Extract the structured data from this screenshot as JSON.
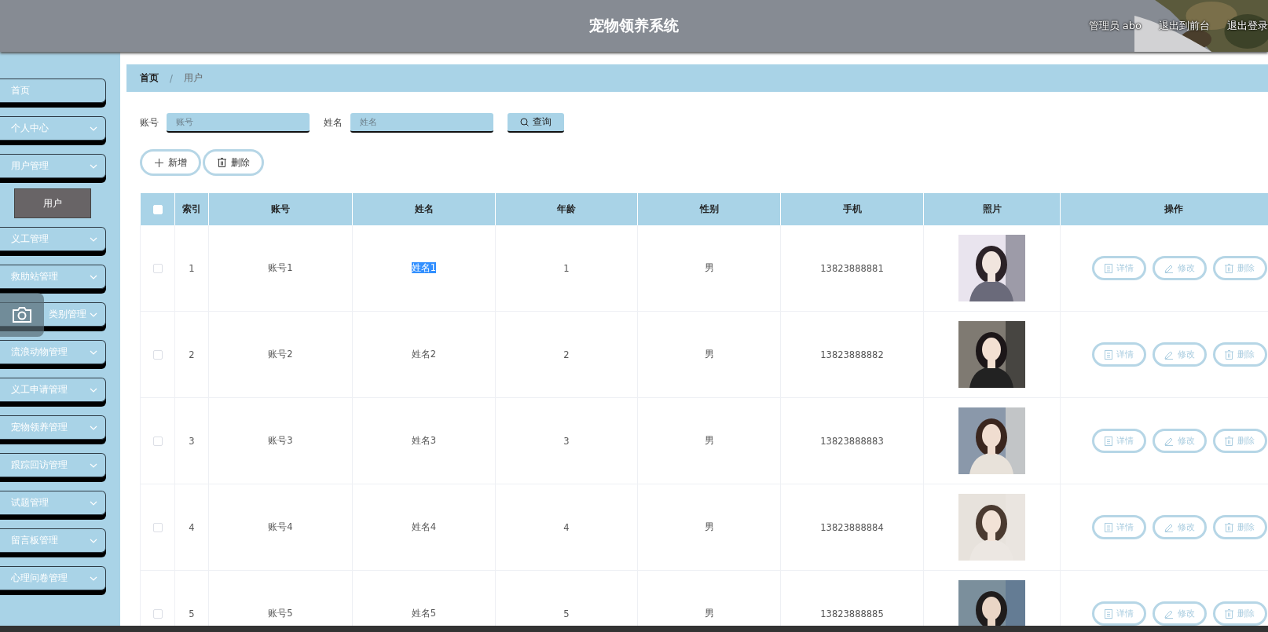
{
  "header": {
    "title": "宠物领养系统",
    "user": "管理员 abo",
    "links": [
      "退出到前台",
      "退出登录"
    ]
  },
  "sidebar": {
    "items": [
      {
        "label": "首页",
        "expandable": false
      },
      {
        "label": "个人中心",
        "expandable": true
      },
      {
        "label": "用户管理",
        "expandable": true,
        "children": [
          {
            "label": "用户",
            "selected": true
          }
        ]
      },
      {
        "label": "义工管理",
        "expandable": true
      },
      {
        "label": "救助站管理",
        "expandable": true
      },
      {
        "label": "类别管理",
        "expandable": true
      },
      {
        "label": "流浪动物管理",
        "expandable": true
      },
      {
        "label": "义工申请管理",
        "expandable": true
      },
      {
        "label": "宠物领养管理",
        "expandable": true
      },
      {
        "label": "跟踪回访管理",
        "expandable": true
      },
      {
        "label": "试题管理",
        "expandable": true
      },
      {
        "label": "留言板管理",
        "expandable": true
      },
      {
        "label": "心理问卷管理",
        "expandable": true
      }
    ]
  },
  "breadcrumb": [
    "首页",
    "用户"
  ],
  "breadcrumb_separator": "/",
  "search": {
    "fields": [
      {
        "label": "账号",
        "placeholder": "账号"
      },
      {
        "label": "姓名",
        "placeholder": "姓名"
      }
    ],
    "button": "查询"
  },
  "actions": [
    {
      "kind": "add",
      "label": "新增"
    },
    {
      "kind": "delete",
      "label": "删除"
    }
  ],
  "table": {
    "all_checked": false,
    "columns": [
      "索引",
      "账号",
      "姓名",
      "年龄",
      "性别",
      "手机",
      "照片",
      "操作"
    ],
    "rows": [
      {
        "checked": false,
        "index": "1",
        "account": "账号1",
        "name": "姓名1",
        "name_highlighted": true,
        "age": "1",
        "gender": "男",
        "phone": "13823888881",
        "actions": [
          {
            "kind": "detail",
            "label": "详情"
          },
          {
            "kind": "edit",
            "label": "修改"
          },
          {
            "kind": "delete",
            "label": "删除"
          }
        ]
      },
      {
        "checked": false,
        "index": "2",
        "account": "账号2",
        "name": "姓名2",
        "name_highlighted": false,
        "age": "2",
        "gender": "男",
        "phone": "13823888882",
        "actions": [
          {
            "kind": "detail",
            "label": "详情"
          },
          {
            "kind": "edit",
            "label": "修改"
          },
          {
            "kind": "delete",
            "label": "删除"
          }
        ]
      },
      {
        "checked": false,
        "index": "3",
        "account": "账号3",
        "name": "姓名3",
        "name_highlighted": false,
        "age": "3",
        "gender": "男",
        "phone": "13823888883",
        "actions": [
          {
            "kind": "detail",
            "label": "详情"
          },
          {
            "kind": "edit",
            "label": "修改"
          },
          {
            "kind": "delete",
            "label": "删除"
          }
        ]
      },
      {
        "checked": false,
        "index": "4",
        "account": "账号4",
        "name": "姓名4",
        "name_highlighted": false,
        "age": "4",
        "gender": "男",
        "phone": "13823888884",
        "actions": [
          {
            "kind": "detail",
            "label": "详情"
          },
          {
            "kind": "edit",
            "label": "修改"
          },
          {
            "kind": "delete",
            "label": "删除"
          }
        ]
      },
      {
        "checked": false,
        "index": "5",
        "account": "账号5",
        "name": "姓名5",
        "name_highlighted": false,
        "age": "5",
        "gender": "男",
        "phone": "13823888885",
        "actions": [
          {
            "kind": "detail",
            "label": "详情"
          },
          {
            "kind": "edit",
            "label": "修改"
          },
          {
            "kind": "delete",
            "label": "删除"
          }
        ]
      }
    ]
  }
}
